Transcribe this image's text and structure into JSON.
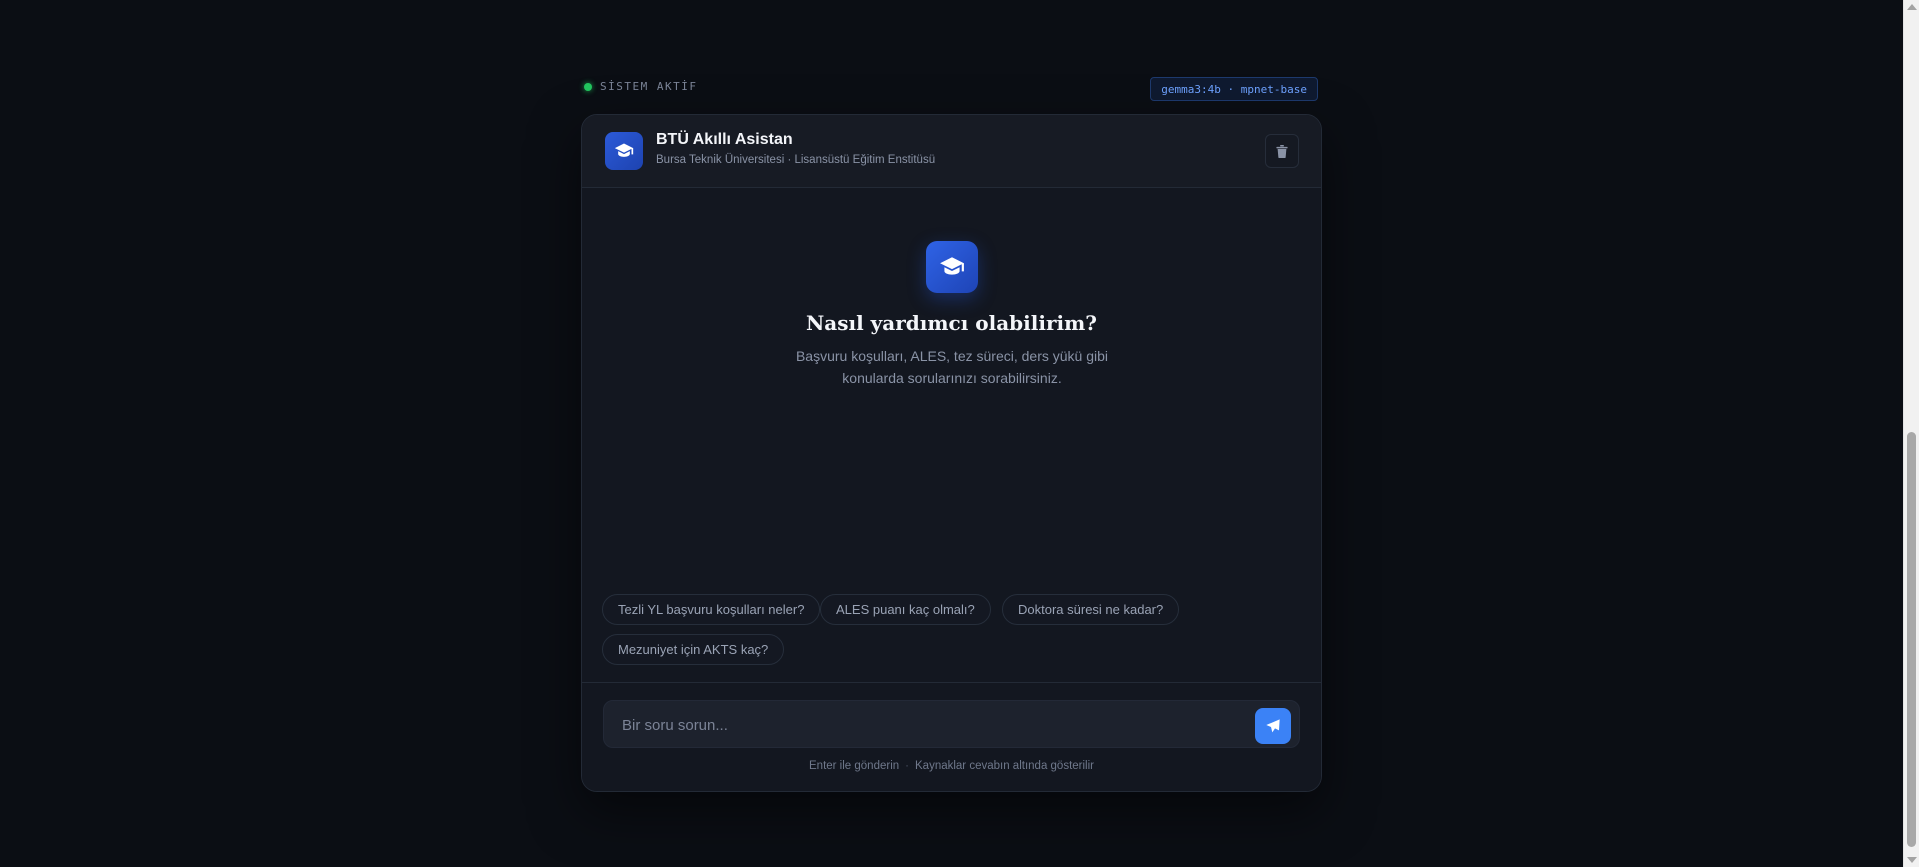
{
  "status": {
    "label": "SİSTEM AKTİF",
    "indicator_color": "#22c55e"
  },
  "model_badge": {
    "label": "gemma3:4b · mpnet-base"
  },
  "header": {
    "title": "BTÜ Akıllı Asistan",
    "subtitle": "Bursa Teknik Üniversitesi · Lisansüstü Eğitim Enstitüsü",
    "logo_icon": "graduation-cap-icon",
    "clear_icon": "trash-icon"
  },
  "hero": {
    "icon": "graduation-cap-icon",
    "title": "Nasıl yardımcı olabilirim?",
    "description": "Başvuru koşulları, ALES, tez süreci, ders yükü gibi konularda sorularınızı sorabilirsiniz."
  },
  "suggestions": [
    "Tezli YL başvuru koşulları neler?",
    "ALES puanı kaç olmalı?",
    "Doktora süresi ne kadar?",
    "Mezuniyet için AKTS kaç?"
  ],
  "composer": {
    "placeholder": "Bir soru sorun...",
    "value": "",
    "send_icon": "paper-plane-icon"
  },
  "footer": {
    "hint_send": "Enter ile gönderin",
    "separator": "·",
    "hint_sources": "Kaynaklar cevabın altında gösterilir"
  },
  "colors": {
    "accent": "#3b82f6",
    "background": "#0b0e14",
    "card": "#131720"
  }
}
